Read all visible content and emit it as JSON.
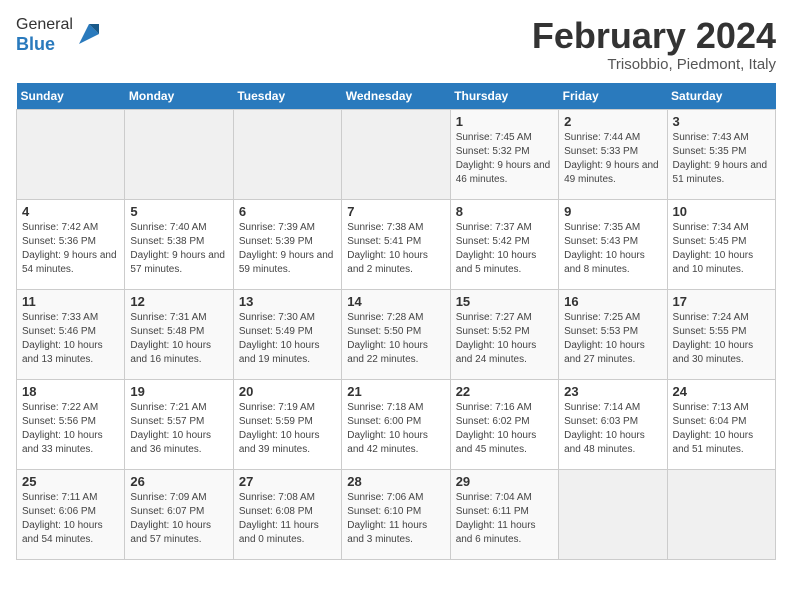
{
  "logo": {
    "general": "General",
    "blue": "Blue"
  },
  "title": "February 2024",
  "subtitle": "Trisobbio, Piedmont, Italy",
  "days_header": [
    "Sunday",
    "Monday",
    "Tuesday",
    "Wednesday",
    "Thursday",
    "Friday",
    "Saturday"
  ],
  "weeks": [
    [
      {
        "day": "",
        "info": ""
      },
      {
        "day": "",
        "info": ""
      },
      {
        "day": "",
        "info": ""
      },
      {
        "day": "",
        "info": ""
      },
      {
        "day": "1",
        "info": "Sunrise: 7:45 AM\nSunset: 5:32 PM\nDaylight: 9 hours and 46 minutes."
      },
      {
        "day": "2",
        "info": "Sunrise: 7:44 AM\nSunset: 5:33 PM\nDaylight: 9 hours and 49 minutes."
      },
      {
        "day": "3",
        "info": "Sunrise: 7:43 AM\nSunset: 5:35 PM\nDaylight: 9 hours and 51 minutes."
      }
    ],
    [
      {
        "day": "4",
        "info": "Sunrise: 7:42 AM\nSunset: 5:36 PM\nDaylight: 9 hours and 54 minutes."
      },
      {
        "day": "5",
        "info": "Sunrise: 7:40 AM\nSunset: 5:38 PM\nDaylight: 9 hours and 57 minutes."
      },
      {
        "day": "6",
        "info": "Sunrise: 7:39 AM\nSunset: 5:39 PM\nDaylight: 9 hours and 59 minutes."
      },
      {
        "day": "7",
        "info": "Sunrise: 7:38 AM\nSunset: 5:41 PM\nDaylight: 10 hours and 2 minutes."
      },
      {
        "day": "8",
        "info": "Sunrise: 7:37 AM\nSunset: 5:42 PM\nDaylight: 10 hours and 5 minutes."
      },
      {
        "day": "9",
        "info": "Sunrise: 7:35 AM\nSunset: 5:43 PM\nDaylight: 10 hours and 8 minutes."
      },
      {
        "day": "10",
        "info": "Sunrise: 7:34 AM\nSunset: 5:45 PM\nDaylight: 10 hours and 10 minutes."
      }
    ],
    [
      {
        "day": "11",
        "info": "Sunrise: 7:33 AM\nSunset: 5:46 PM\nDaylight: 10 hours and 13 minutes."
      },
      {
        "day": "12",
        "info": "Sunrise: 7:31 AM\nSunset: 5:48 PM\nDaylight: 10 hours and 16 minutes."
      },
      {
        "day": "13",
        "info": "Sunrise: 7:30 AM\nSunset: 5:49 PM\nDaylight: 10 hours and 19 minutes."
      },
      {
        "day": "14",
        "info": "Sunrise: 7:28 AM\nSunset: 5:50 PM\nDaylight: 10 hours and 22 minutes."
      },
      {
        "day": "15",
        "info": "Sunrise: 7:27 AM\nSunset: 5:52 PM\nDaylight: 10 hours and 24 minutes."
      },
      {
        "day": "16",
        "info": "Sunrise: 7:25 AM\nSunset: 5:53 PM\nDaylight: 10 hours and 27 minutes."
      },
      {
        "day": "17",
        "info": "Sunrise: 7:24 AM\nSunset: 5:55 PM\nDaylight: 10 hours and 30 minutes."
      }
    ],
    [
      {
        "day": "18",
        "info": "Sunrise: 7:22 AM\nSunset: 5:56 PM\nDaylight: 10 hours and 33 minutes."
      },
      {
        "day": "19",
        "info": "Sunrise: 7:21 AM\nSunset: 5:57 PM\nDaylight: 10 hours and 36 minutes."
      },
      {
        "day": "20",
        "info": "Sunrise: 7:19 AM\nSunset: 5:59 PM\nDaylight: 10 hours and 39 minutes."
      },
      {
        "day": "21",
        "info": "Sunrise: 7:18 AM\nSunset: 6:00 PM\nDaylight: 10 hours and 42 minutes."
      },
      {
        "day": "22",
        "info": "Sunrise: 7:16 AM\nSunset: 6:02 PM\nDaylight: 10 hours and 45 minutes."
      },
      {
        "day": "23",
        "info": "Sunrise: 7:14 AM\nSunset: 6:03 PM\nDaylight: 10 hours and 48 minutes."
      },
      {
        "day": "24",
        "info": "Sunrise: 7:13 AM\nSunset: 6:04 PM\nDaylight: 10 hours and 51 minutes."
      }
    ],
    [
      {
        "day": "25",
        "info": "Sunrise: 7:11 AM\nSunset: 6:06 PM\nDaylight: 10 hours and 54 minutes."
      },
      {
        "day": "26",
        "info": "Sunrise: 7:09 AM\nSunset: 6:07 PM\nDaylight: 10 hours and 57 minutes."
      },
      {
        "day": "27",
        "info": "Sunrise: 7:08 AM\nSunset: 6:08 PM\nDaylight: 11 hours and 0 minutes."
      },
      {
        "day": "28",
        "info": "Sunrise: 7:06 AM\nSunset: 6:10 PM\nDaylight: 11 hours and 3 minutes."
      },
      {
        "day": "29",
        "info": "Sunrise: 7:04 AM\nSunset: 6:11 PM\nDaylight: 11 hours and 6 minutes."
      },
      {
        "day": "",
        "info": ""
      },
      {
        "day": "",
        "info": ""
      }
    ]
  ]
}
